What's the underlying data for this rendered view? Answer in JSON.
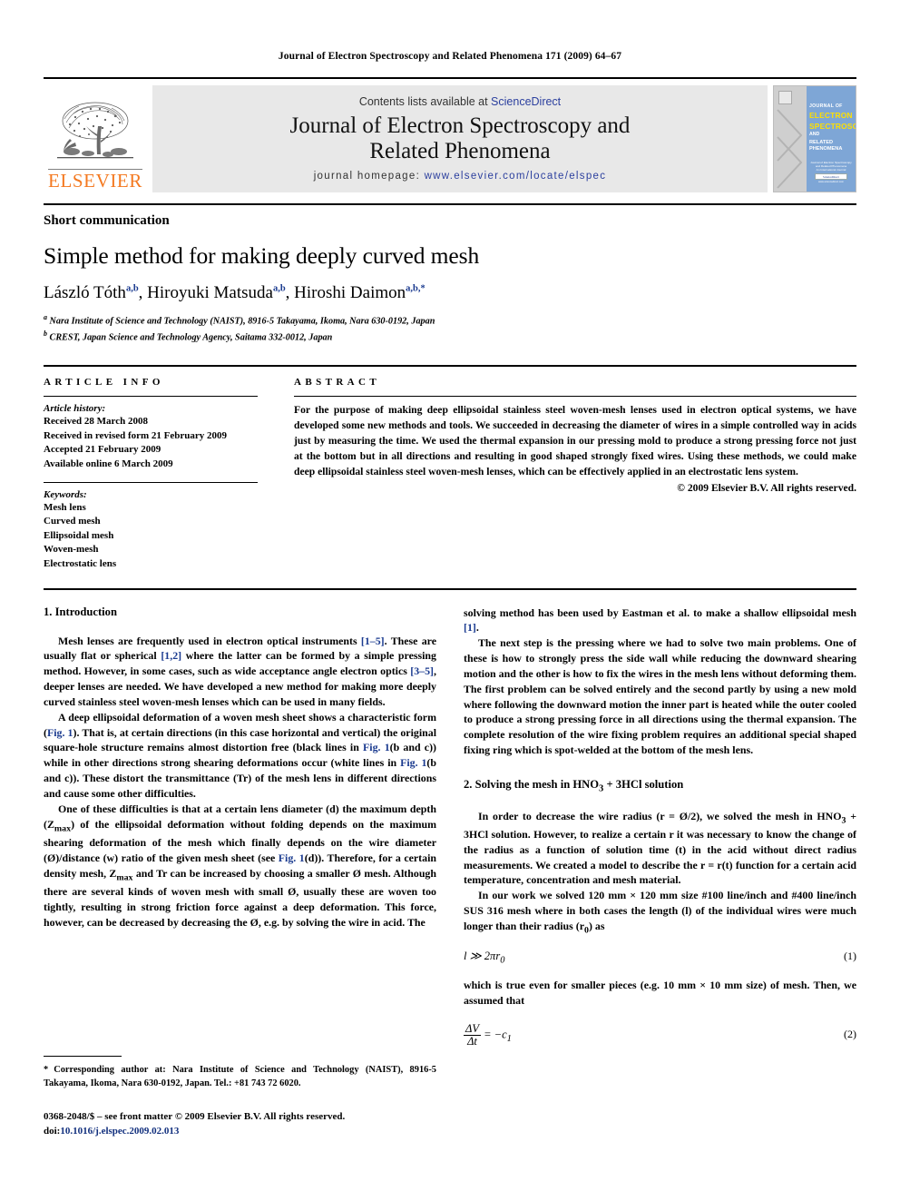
{
  "running_head": "Journal of Electron Spectroscopy and Related Phenomena 171 (2009) 64–67",
  "masthead": {
    "publisher_name": "ELSEVIER",
    "contents_prefix": "Contents lists available at ",
    "contents_link": "ScienceDirect",
    "journal_title_line1": "Journal of Electron Spectroscopy and",
    "journal_title_line2": "Related Phenomena",
    "homepage_prefix": "journal homepage: ",
    "homepage_url": "www.elsevier.com/locate/elspec",
    "cover": {
      "line1": "JOURNAL OF",
      "line2": "ELECTRON",
      "line3": "SPECTROSCOPY",
      "line4": "AND",
      "line5": "RELATED PHENOMENA",
      "foot1": "Journal of Electron Spectroscopy and Related Phenomena",
      "foot2": "An International Journal",
      "sd_badge": "ScienceDirect",
      "sd_url": "www.sciencedirect.com",
      "bg_color": "#7ea6d6",
      "band_color": "#cfcfcf",
      "accent_color": "#ffe000"
    }
  },
  "article": {
    "type": "Short communication",
    "title": "Simple method for making deeply curved mesh",
    "authors": [
      {
        "name": "László Tóth",
        "marks": "a,b"
      },
      {
        "name": "Hiroyuki Matsuda",
        "marks": "a,b"
      },
      {
        "name": "Hiroshi Daimon",
        "marks": "a,b,*"
      }
    ],
    "affiliations": [
      {
        "mark": "a",
        "text": "Nara Institute of Science and Technology (NAIST), 8916-5 Takayama, Ikoma, Nara 630-0192, Japan"
      },
      {
        "mark": "b",
        "text": "CREST, Japan Science and Technology Agency, Saitama 332-0012, Japan"
      }
    ]
  },
  "article_info": {
    "heading": "ARTICLE INFO",
    "history_title": "Article history:",
    "history": [
      "Received 28 March 2008",
      "Received in revised form 21 February 2009",
      "Accepted 21 February 2009",
      "Available online 6 March 2009"
    ],
    "keywords_title": "Keywords:",
    "keywords": [
      "Mesh lens",
      "Curved mesh",
      "Ellipsoidal mesh",
      "Woven-mesh",
      "Electrostatic lens"
    ]
  },
  "abstract": {
    "heading": "ABSTRACT",
    "text": "For the purpose of making deep ellipsoidal stainless steel woven-mesh lenses used in electron optical systems, we have developed some new methods and tools. We succeeded in decreasing the diameter of wires in a simple controlled way in acids just by measuring the time. We used the thermal expansion in our pressing mold to produce a strong pressing force not just at the bottom but in all directions and resulting in good shaped strongly fixed wires. Using these methods, we could make deep ellipsoidal stainless steel woven-mesh lenses, which can be effectively applied in an electrostatic lens system.",
    "copyright": "© 2009 Elsevier B.V. All rights reserved."
  },
  "sections": {
    "intro_heading": "1. Introduction",
    "intro_p1_a": "Mesh lenses are frequently used in electron optical instruments ",
    "intro_p1_c1": "[1–5]",
    "intro_p1_b": ". These are usually flat or spherical ",
    "intro_p1_c2": "[1,2]",
    "intro_p1_d": " where the latter can be formed by a simple pressing method. However, in some cases, such as wide acceptance angle electron optics ",
    "intro_p1_c3": "[3–5]",
    "intro_p1_e": ", deeper lenses are needed. We have developed a new method for making more deeply curved stainless steel woven-mesh lenses which can be used in many fields.",
    "intro_p2_a": "A deep ellipsoidal deformation of a woven mesh sheet shows a characteristic form (",
    "intro_p2_c1": "Fig. 1",
    "intro_p2_b": "). That is, at certain directions (in this case horizontal and vertical) the original square-hole structure remains almost distortion free (black lines in ",
    "intro_p2_c2": "Fig. 1",
    "intro_p2_d": "(b and c)) while in other directions strong shearing deformations occur (white lines in ",
    "intro_p2_c3": "Fig. 1",
    "intro_p2_e": "(b and c)). These distort the transmittance (Tr) of the mesh lens in different directions and cause some other difficulties.",
    "intro_p3_a": "One of these difficulties is that at a certain lens diameter (d) the maximum depth (Z",
    "intro_p3_sub": "max",
    "intro_p3_b": ") of the ellipsoidal deformation without folding depends on the maximum shearing deformation of the mesh which finally depends on the wire diameter (Ø)/distance (w) ratio of the given mesh sheet (see ",
    "intro_p3_c1": "Fig. 1",
    "intro_p3_c": "(d)). Therefore, for a certain density mesh, Z",
    "intro_p3_sub2": "max",
    "intro_p3_d": " and Tr can be increased by choosing a smaller Ø mesh. Although there are several kinds of woven mesh with small Ø, usually these are woven too tightly, resulting in strong friction force against a deep deformation. This force, however, can be decreased by decreasing the Ø, e.g. by solving the wire in acid. The",
    "right_p1_a": "solving method has been used by Eastman et al. to make a shallow ellipsoidal mesh ",
    "right_p1_c1": "[1]",
    "right_p1_b": ".",
    "right_p2": "The next step is the pressing where we had to solve two main problems. One of these is how to strongly press the side wall while reducing the downward shearing motion and the other is how to fix the wires in the mesh lens without deforming them. The first problem can be solved entirely and the second partly by using a new mold where following the downward motion the inner part is heated while the outer cooled to produce a strong pressing force in all directions using the thermal expansion. The complete resolution of the wire fixing problem requires an additional special shaped fixing ring which is spot-welded at the bottom of the mesh lens.",
    "sec2_heading_a": "2. Solving the mesh in HNO",
    "sec2_heading_sub": "3",
    "sec2_heading_b": " + 3HCl solution",
    "sec2_p1_a": "In order to decrease the wire radius (r = Ø/2), we solved the mesh in HNO",
    "sec2_p1_sub": "3",
    "sec2_p1_b": " + 3HCl solution. However, to realize a certain r it was necessary to know the change of the radius as a function of solution time (t) in the acid without direct radius measurements. We created a model to describe the r = r(t) function for a certain acid temperature, concentration and mesh material.",
    "sec2_p2_a": "In our work we solved 120 mm × 120 mm size #100 line/inch and #400 line/inch SUS 316 mesh where in both cases the length (l) of the individual wires were much longer than their radius (r",
    "sec2_p2_sub": "0",
    "sec2_p2_b": ") as",
    "eq1_lhs": "l ≫ 2πr",
    "eq1_sub": "0",
    "eq1_num": "(1)",
    "sec2_p3": "which is true even for smaller pieces (e.g. 10 mm × 10 mm size) of mesh. Then, we assumed that",
    "eq2_num": "ΔV",
    "eq2_den": "Δt",
    "eq2_rhs_a": " = −c",
    "eq2_rhs_sub": "1",
    "eq2_number": "(2)"
  },
  "footnotes": {
    "star": "*",
    "corresponding": "Corresponding author at: Nara Institute of Science and Technology (NAIST), 8916-5 Takayama, Ikoma, Nara 630-0192, Japan. Tel.: +81 743 72 6020.",
    "issn_line": "0368-2048/$ – see front matter © 2009 Elsevier B.V. All rights reserved.",
    "doi_prefix": "doi:",
    "doi_value": "10.1016/j.elspec.2009.02.013"
  }
}
